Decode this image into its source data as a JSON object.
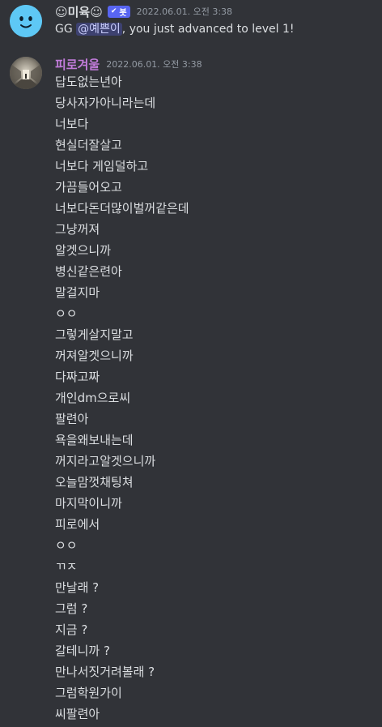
{
  "bot_message": {
    "username": "☺미육☺",
    "tag_label": "봇",
    "timestamp": "2022.06.01. 오전 3:38",
    "text_prefix": "GG ",
    "mention": "@예쁜이",
    "text_suffix": ", you just advanced to level 1!"
  },
  "user_message": {
    "username": "피로겨울",
    "timestamp": "2022.06.01. 오전 3:38",
    "lines": [
      "답도없는년아",
      "당사자가아니라는데",
      "너보다",
      "현실더잘살고",
      "너보다 게임덜하고",
      "가끔들어오고",
      "너보다돈더많이벌꺼같은데",
      "그냥꺼져",
      "알겟으니까",
      "병신같은련아",
      "말걸지마",
      "ㅇㅇ",
      "그렇게살지말고",
      "꺼져알겟으니까",
      "다짜고짜",
      "개인dm으로씨",
      "팔련아",
      "욕을왜보내는데",
      "꺼지라고알겟으니까",
      "오늘맘껏채팅쳐",
      "마지막이니까",
      "피로에서",
      "ㅇㅇ",
      "ㄲㅈ",
      "만날래 ?",
      "그럼 ?",
      "지금 ?",
      "갈테니까 ?",
      "만나서짓거려볼래 ?",
      "그럼학원가이",
      "씨팔련아"
    ]
  },
  "colors": {
    "background": "#313338",
    "text": "#dbdee1",
    "muted": "#949ba4",
    "user_name": "#c27cdb",
    "bot_tag": "#5865f2",
    "bot_avatar": "#5ec8f5"
  },
  "icons": {
    "bot_avatar": "smiley-face-icon",
    "user_avatar": "photo-avatar",
    "verified": "check-icon"
  }
}
